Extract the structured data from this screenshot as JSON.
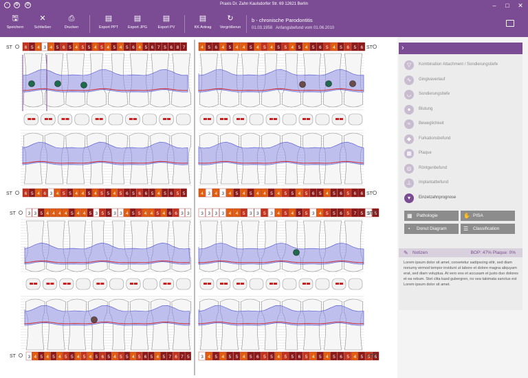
{
  "window": {
    "title": "Praxis Dr. Zahn Kaulsdorfer Str. 69 12621 Berlin"
  },
  "toolbar": {
    "save": "Speichern",
    "close": "Schließen",
    "print": "Drucken",
    "export_ppt": "Export PPT",
    "export_jpg": "Export JPG",
    "export_pv": "Export PV",
    "kk_antrag": "KK Antrag",
    "enlarge": "Vergrößerun"
  },
  "patient": {
    "diagnosis": "b - chronische Parodontitis",
    "birthdate": "01.03.1958",
    "finding": "Anfangsbefund vom 01.06.2010"
  },
  "chart": {
    "st_label": "ST",
    "upper_top_cells": [
      "6",
      "5",
      "4",
      "3",
      "4",
      "5",
      "6",
      "5",
      "4",
      "5",
      "5",
      "4",
      "5",
      "4",
      "5",
      "4",
      "5",
      "6",
      "4",
      "5",
      "6",
      "7",
      "5",
      "6",
      "8",
      "7"
    ],
    "upper_top_cells_right": [
      "4",
      "5",
      "6",
      "4",
      "5",
      "4",
      "4",
      "5",
      "4",
      "5",
      "4",
      "5",
      "5",
      "4",
      "5",
      "4",
      "5",
      "6",
      "5",
      "4",
      "5",
      "6",
      "5",
      "6"
    ],
    "upper_bottom_cells": [
      "6",
      "5",
      "4",
      "6",
      "3",
      "4",
      "5",
      "5",
      "4",
      "4",
      "5",
      "4",
      "5",
      "5",
      "4",
      "5",
      "6",
      "5",
      "6",
      "6",
      "5",
      "4",
      "5",
      "6",
      "5",
      "5"
    ],
    "upper_bottom_cells_right": [
      "4",
      "3",
      "4",
      "3",
      "4",
      "5",
      "4",
      "5",
      "4",
      "4",
      "5",
      "4",
      "5",
      "5",
      "4",
      "5",
      "6",
      "5",
      "4",
      "5",
      "6",
      "5",
      "6",
      "6"
    ],
    "lower_top_cells": [
      "3",
      "3",
      "5",
      "4",
      "4",
      "4",
      "4",
      "5",
      "4",
      "4",
      "5",
      "3",
      "5",
      "5",
      "3",
      "3",
      "4",
      "5",
      "5",
      "4",
      "4",
      "5",
      "4",
      "6",
      "6",
      "3",
      "3"
    ],
    "lower_top_cells_right": [
      "3",
      "3",
      "3",
      "3",
      "4",
      "4",
      "5",
      "3",
      "3",
      "5",
      "3",
      "4",
      "5",
      "4",
      "5",
      "5",
      "3",
      "4",
      "5",
      "5",
      "6",
      "5",
      "7",
      "5",
      "3",
      "5"
    ],
    "lower_bottom_cells": [
      "3",
      "4",
      "5",
      "4",
      "5",
      "4",
      "5",
      "5",
      "4",
      "5",
      "4",
      "5",
      "6",
      "5",
      "4",
      "5",
      "5",
      "4",
      "5",
      "6",
      "5",
      "4",
      "5",
      "7",
      "6",
      "7",
      "5"
    ],
    "lower_bottom_cells_right": [
      "3",
      "4",
      "5",
      "4",
      "5",
      "5",
      "4",
      "5",
      "6",
      "5",
      "5",
      "4",
      "5",
      "5",
      "6",
      "5",
      "4",
      "5",
      "4",
      "5",
      "6",
      "5",
      "4",
      "5",
      "5",
      "6"
    ]
  },
  "sidebar": {
    "collapse_glyph": "›",
    "items": [
      {
        "label": "Kombination Attachment / Sondierungstiefe",
        "icon": "attachment-icon",
        "glyph": "▽"
      },
      {
        "label": "Gingivaverlauf",
        "icon": "gingiva-icon",
        "glyph": "∿"
      },
      {
        "label": "Sondierungstiefe",
        "icon": "probe-depth-icon",
        "glyph": "◡"
      },
      {
        "label": "Blutung",
        "icon": "blood-drop-icon",
        "glyph": "●"
      },
      {
        "label": "Beweglichkeit",
        "icon": "mobility-icon",
        "glyph": "≈"
      },
      {
        "label": "Furkationsbefund",
        "icon": "furcation-icon",
        "glyph": "◆"
      },
      {
        "label": "Plaque",
        "icon": "plaque-icon",
        "glyph": "▦"
      },
      {
        "label": "Röntgenbefund",
        "icon": "xray-icon",
        "glyph": "◎"
      },
      {
        "label": "Implantatbefund",
        "icon": "implant-icon",
        "glyph": "⊥"
      },
      {
        "label": "Einzelzahnprognose",
        "icon": "tooth-prognosis-icon",
        "glyph": "▾"
      }
    ],
    "buttons": [
      {
        "label": "Pathologie",
        "glyph": "▦"
      },
      {
        "label": "PISA",
        "glyph": "✋"
      },
      {
        "label": "Donut Diagram",
        "glyph": "◔"
      },
      {
        "label": "Classification",
        "glyph": "☰"
      }
    ]
  },
  "notes": {
    "title": "Notizen",
    "edit_glyph": "✎",
    "stats": "BOP: 47% Plaque: 0%",
    "text": "Lorem ipsum dolor sit amet, consetetur sadipscing elitr, sed diam nonumy eirmod tempor invidunt ut labore et dolore magna aliquyam erat, sed diam voluptua. At vero eos et accusam et justo duo dolores et ea rebum. Stet clita kasd gubergren, no sea takimata sanctus est Lorem ipsum dolor sit amet."
  },
  "colors": {
    "brand": "#7b4b93",
    "severe": "#8b1a1a",
    "moderate": "#e25d0c",
    "mild": "#f5b48e",
    "band": "#8f92e6"
  }
}
